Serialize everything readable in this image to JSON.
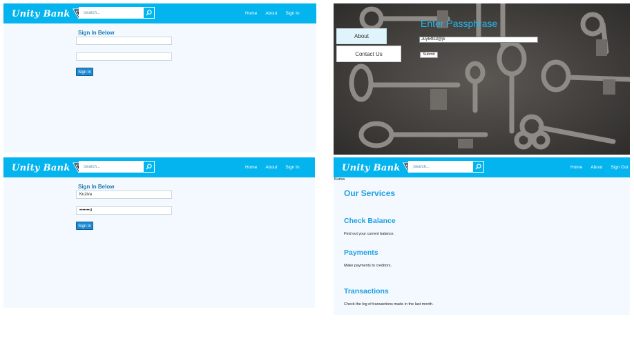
{
  "brand": {
    "logo_text": "Unity Bank"
  },
  "colors": {
    "header": "#04b4ee",
    "panel_bg": "#f3f9fe",
    "title_blue": "#1f7ab3",
    "accent": "#1f9fe3"
  },
  "panels": {
    "signin_empty": {
      "search_placeholder": "Search...",
      "nav": [
        "Home",
        "About",
        "Sign In"
      ],
      "form_title": "Sign In Below",
      "username": "",
      "password": "",
      "button": "Sign In"
    },
    "passphrase": {
      "menu": [
        "About",
        "Contact Us"
      ],
      "title": "Enter Passphrase",
      "input_value": "Juy64ts3@jk",
      "submit": "Submit"
    },
    "signin_filled": {
      "search_placeholder": "Search...",
      "nav": [
        "Home",
        "About",
        "Sign In"
      ],
      "form_title": "Sign In Below",
      "username": "Kuziva",
      "password": "•••••••d",
      "button": "Sign In"
    },
    "services": {
      "search_placeholder": "Search...",
      "nav": [
        "Home",
        "About",
        "Sign Out"
      ],
      "user": "Kuziva",
      "heading": "Our Services",
      "items": [
        {
          "title": "Check Balance",
          "desc": "Find out your current balance."
        },
        {
          "title": "Payments",
          "desc": "Make payments to creditors."
        },
        {
          "title": "Transactions",
          "desc": "Check the log of transactions made in the last month."
        }
      ]
    }
  }
}
